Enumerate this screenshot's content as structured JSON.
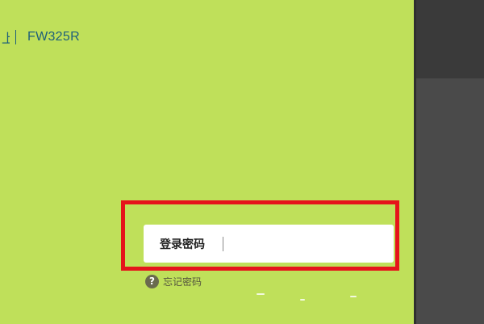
{
  "header": {
    "brand_glyph": "上",
    "model": "FW325R"
  },
  "login": {
    "password_label": "登录密码",
    "password_value": "",
    "password_placeholder": ""
  },
  "forgot": {
    "icon_glyph": "?",
    "label": "忘记密码"
  },
  "colors": {
    "page_background": "#bfe05a",
    "highlight_border": "#e5141b",
    "brand_text": "#1d5f7a",
    "side_frame": "#4a4a4a"
  },
  "icons": {
    "help": "question-circle-icon"
  }
}
